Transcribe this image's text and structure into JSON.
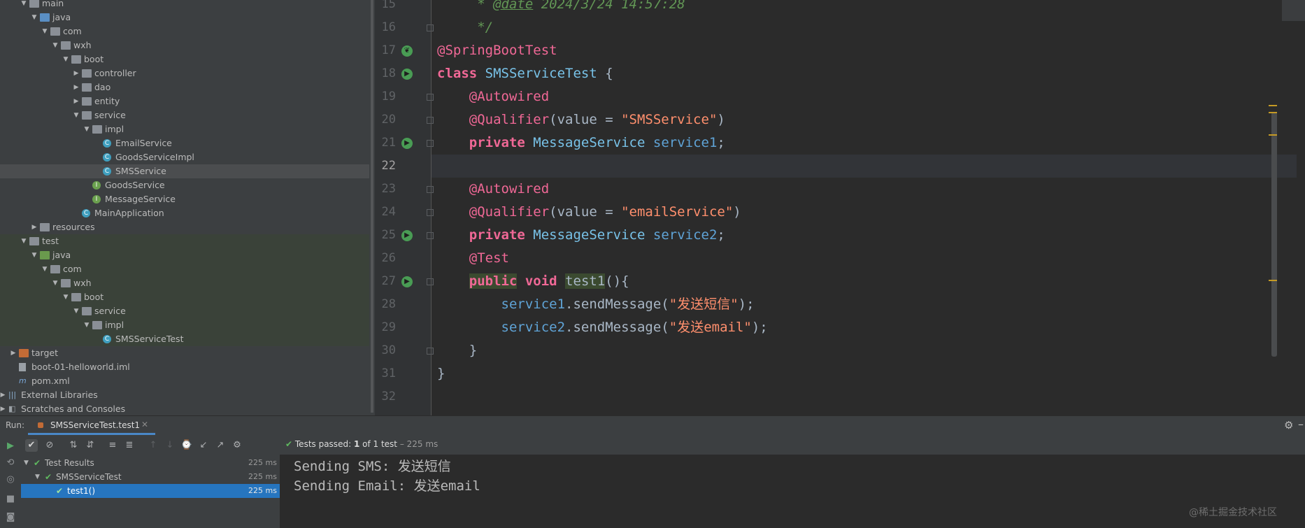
{
  "project_tree": {
    "items": [
      {
        "label": "main",
        "expanded": true,
        "icon": "folder-icon"
      },
      {
        "label": "java",
        "expanded": true,
        "icon": "source-folder-icon"
      },
      {
        "label": "com",
        "expanded": true,
        "icon": "package-icon"
      },
      {
        "label": "wxh",
        "expanded": true,
        "icon": "package-icon"
      },
      {
        "label": "boot",
        "expanded": true,
        "icon": "package-icon"
      },
      {
        "label": "controller",
        "expanded": false,
        "icon": "package-icon"
      },
      {
        "label": "dao",
        "expanded": false,
        "icon": "package-icon"
      },
      {
        "label": "entity",
        "expanded": false,
        "icon": "package-icon"
      },
      {
        "label": "service",
        "expanded": true,
        "icon": "package-icon"
      },
      {
        "label": "impl",
        "expanded": true,
        "icon": "package-icon"
      },
      {
        "label": "EmailService",
        "icon": "class-icon"
      },
      {
        "label": "GoodsServiceImpl",
        "icon": "class-icon"
      },
      {
        "label": "SMSService",
        "icon": "class-icon",
        "selected": true
      },
      {
        "label": "GoodsService",
        "icon": "interface-icon"
      },
      {
        "label": "MessageService",
        "icon": "interface-icon"
      },
      {
        "label": "MainApplication",
        "icon": "spring-class-icon"
      },
      {
        "label": "resources",
        "expanded": false,
        "icon": "resources-folder-icon"
      },
      {
        "label": "test",
        "expanded": true,
        "icon": "folder-icon"
      },
      {
        "label": "java",
        "expanded": true,
        "icon": "test-source-folder-icon"
      },
      {
        "label": "com",
        "expanded": true,
        "icon": "package-icon"
      },
      {
        "label": "wxh",
        "expanded": true,
        "icon": "package-icon"
      },
      {
        "label": "boot",
        "expanded": true,
        "icon": "package-icon"
      },
      {
        "label": "service",
        "expanded": true,
        "icon": "package-icon"
      },
      {
        "label": "impl",
        "expanded": true,
        "icon": "package-icon"
      },
      {
        "label": "SMSServiceTest",
        "icon": "class-icon"
      },
      {
        "label": "target",
        "expanded": false,
        "icon": "excluded-folder-icon"
      },
      {
        "label": "boot-01-helloworld.iml",
        "icon": "iml-file-icon"
      },
      {
        "label": "pom.xml",
        "icon": "maven-file-icon"
      },
      {
        "label": "External Libraries",
        "expanded": false,
        "icon": "libraries-icon"
      },
      {
        "label": "Scratches and Consoles",
        "expanded": false,
        "icon": "scratches-icon"
      }
    ]
  },
  "editor": {
    "current_line": "22",
    "lines": [
      {
        "num": "15",
        "parts": [
          {
            "t": "     * ",
            "c": "cmt"
          },
          {
            "t": "@date",
            "c": "cmtag"
          },
          {
            "t": " 2024/3/24 14:57:28",
            "c": "cmt"
          }
        ]
      },
      {
        "num": "16",
        "parts": [
          {
            "t": "     */",
            "c": "cmt"
          }
        ]
      },
      {
        "num": "17",
        "parts": [
          {
            "t": "@SpringBootTest",
            "c": "ann"
          }
        ]
      },
      {
        "num": "18",
        "parts": [
          {
            "t": "class ",
            "c": "kw2"
          },
          {
            "t": "SMSServiceTest",
            "c": "cls2"
          },
          {
            "t": " {",
            "c": ""
          }
        ]
      },
      {
        "num": "19",
        "parts": [
          {
            "t": "    ",
            "c": ""
          },
          {
            "t": "@Autowired",
            "c": "ann"
          }
        ]
      },
      {
        "num": "20",
        "parts": [
          {
            "t": "    ",
            "c": ""
          },
          {
            "t": "@Qualifier",
            "c": "ann"
          },
          {
            "t": "(value = ",
            "c": ""
          },
          {
            "t": "\"SMSService\"",
            "c": "str"
          },
          {
            "t": ")",
            "c": ""
          }
        ]
      },
      {
        "num": "21",
        "parts": [
          {
            "t": "    ",
            "c": ""
          },
          {
            "t": "private ",
            "c": "kw2"
          },
          {
            "t": "MessageService ",
            "c": "cls2"
          },
          {
            "t": "service1",
            "c": "fld"
          },
          {
            "t": ";",
            "c": ""
          }
        ]
      },
      {
        "num": "22",
        "parts": []
      },
      {
        "num": "23",
        "parts": [
          {
            "t": "    ",
            "c": ""
          },
          {
            "t": "@Autowired",
            "c": "ann"
          }
        ]
      },
      {
        "num": "24",
        "parts": [
          {
            "t": "    ",
            "c": ""
          },
          {
            "t": "@Qualifier",
            "c": "ann"
          },
          {
            "t": "(value = ",
            "c": ""
          },
          {
            "t": "\"emailService\"",
            "c": "str"
          },
          {
            "t": ")",
            "c": ""
          }
        ]
      },
      {
        "num": "25",
        "parts": [
          {
            "t": "    ",
            "c": ""
          },
          {
            "t": "private ",
            "c": "kw2"
          },
          {
            "t": "MessageService ",
            "c": "cls2"
          },
          {
            "t": "service2",
            "c": "fld"
          },
          {
            "t": ";",
            "c": ""
          }
        ]
      },
      {
        "num": "26",
        "parts": [
          {
            "t": "    ",
            "c": ""
          },
          {
            "t": "@Test",
            "c": "ann"
          }
        ]
      },
      {
        "num": "27",
        "parts": [
          {
            "t": "    ",
            "c": ""
          },
          {
            "t": "public",
            "c": "kw2 hl"
          },
          {
            "t": " ",
            "c": ""
          },
          {
            "t": "void ",
            "c": "kw2"
          },
          {
            "t": "test1",
            "c": "hl"
          },
          {
            "t": "(){",
            "c": ""
          }
        ]
      },
      {
        "num": "28",
        "parts": [
          {
            "t": "        ",
            "c": ""
          },
          {
            "t": "service1",
            "c": "fld"
          },
          {
            "t": ".sendMessage(",
            "c": ""
          },
          {
            "t": "\"发送短信\"",
            "c": "str"
          },
          {
            "t": ");",
            "c": ""
          }
        ]
      },
      {
        "num": "29",
        "parts": [
          {
            "t": "        ",
            "c": ""
          },
          {
            "t": "service2",
            "c": "fld"
          },
          {
            "t": ".sendMessage(",
            "c": ""
          },
          {
            "t": "\"发送email\"",
            "c": "str"
          },
          {
            "t": ");",
            "c": ""
          }
        ]
      },
      {
        "num": "30",
        "parts": [
          {
            "t": "    }",
            "c": ""
          }
        ]
      },
      {
        "num": "31",
        "parts": [
          {
            "t": "}",
            "c": ""
          }
        ]
      },
      {
        "num": "32",
        "parts": []
      }
    ]
  },
  "run_panel": {
    "label": "Run:",
    "tab_label": "SMSServiceTest.test1",
    "status_check": "✔",
    "status_text": "Tests passed:",
    "status_count": "1",
    "status_of": "of 1 test",
    "status_time": "– 225 ms",
    "results": [
      {
        "label": "Test Results",
        "time": "225 ms",
        "indent": 0,
        "expanded": true
      },
      {
        "label": "SMSServiceTest",
        "time": "225 ms",
        "indent": 1,
        "expanded": true
      },
      {
        "label": "test1()",
        "time": "225 ms",
        "indent": 2,
        "selected": true
      }
    ],
    "console_lines": [
      "Sending SMS: 发送短信",
      "Sending Email: 发送email"
    ]
  },
  "watermark": "@稀土掘金技术社区",
  "colors": {
    "accent": "#4a88c7",
    "selection": "#2675bf",
    "passed": "#5fb85f",
    "annotation": "#f06896",
    "string": "#ff8f6d",
    "class": "#78c2e8"
  }
}
